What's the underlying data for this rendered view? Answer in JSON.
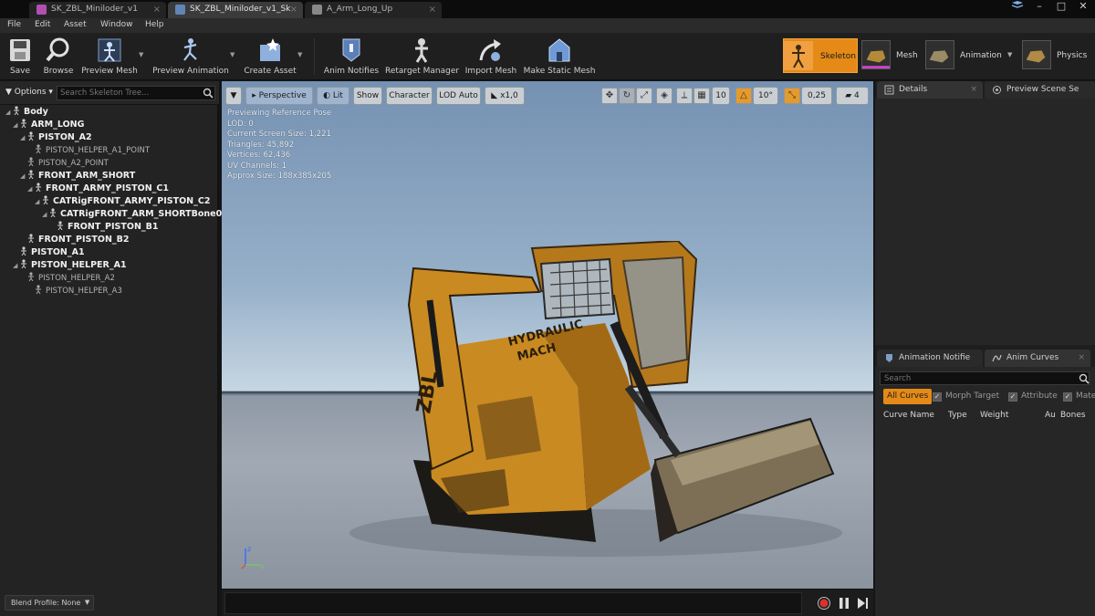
{
  "tabs": [
    {
      "label": "SK_ZBL_Miniloder_v1",
      "icon_color": "#b04fb0"
    },
    {
      "label": "SK_ZBL_Miniloder_v1_Sk",
      "icon_color": "#88c0ff"
    },
    {
      "label": "A_Arm_Long_Up",
      "icon_color": "#aaaaaa"
    }
  ],
  "window_controls": {
    "minimize": "–",
    "maximize": "□",
    "close": "✕"
  },
  "menu": [
    "File",
    "Edit",
    "Asset",
    "Window",
    "Help"
  ],
  "toolbar": {
    "buttons": [
      {
        "label": "Save",
        "icon": "save-icon"
      },
      {
        "label": "Browse",
        "icon": "browse-icon"
      },
      {
        "label": "Preview Mesh",
        "icon": "preview-mesh-icon"
      },
      {
        "label": "Preview Animation",
        "icon": "preview-animation-icon"
      },
      {
        "label": "Create Asset",
        "icon": "create-asset-icon"
      },
      {
        "label": "Anim Notifies",
        "icon": "anim-notifies-icon"
      },
      {
        "label": "Retarget Manager",
        "icon": "retarget-manager-icon"
      },
      {
        "label": "Import Mesh",
        "icon": "import-mesh-icon"
      },
      {
        "label": "Make Static Mesh",
        "icon": "make-static-mesh-icon"
      }
    ],
    "modes": [
      {
        "label": "Skeleton",
        "active": true
      },
      {
        "label": "Mesh",
        "active": false
      },
      {
        "label": "Animation",
        "active": false
      },
      {
        "label": "Physics",
        "active": false
      }
    ],
    "accent": "#e58a17"
  },
  "skeleton_panel": {
    "options_label": "Options",
    "search_placeholder": "Search Skeleton Tree...",
    "bones": [
      {
        "name": "Body",
        "strong": true
      },
      {
        "name": "ARM_LONG",
        "strong": true
      },
      {
        "name": "PISTON_A2",
        "strong": true
      },
      {
        "name": "PISTON_HELPER_A1_POINT",
        "strong": false
      },
      {
        "name": "PISTON_A2_POINT",
        "strong": false
      },
      {
        "name": "FRONT_ARM_SHORT",
        "strong": true
      },
      {
        "name": "FRONT_ARMY_PISTON_C1",
        "strong": true
      },
      {
        "name": "CATRigFRONT_ARMY_PISTON_C2",
        "strong": true
      },
      {
        "name": "CATRigFRONT_ARM_SHORTBone0",
        "strong": true
      },
      {
        "name": "FRONT_PISTON_B1",
        "strong": true
      },
      {
        "name": "FRONT_PISTON_B2",
        "strong": true
      },
      {
        "name": "PISTON_A1",
        "strong": true
      },
      {
        "name": "PISTON_HELPER_A1",
        "strong": true
      },
      {
        "name": "PISTON_HELPER_A2",
        "strong": false
      },
      {
        "name": "PISTON_HELPER_A3",
        "strong": false
      }
    ],
    "blend_profile": "Blend Profile: None"
  },
  "viewport": {
    "buttons": {
      "perspective": "Perspective",
      "lit": "Lit",
      "show": "Show",
      "character": "Character",
      "lod": "LOD Auto",
      "speed": "x1,0"
    },
    "grid_size": "10",
    "rotation_snap": "10°",
    "scale_snap": "0,25",
    "camera_speed": "4",
    "info": [
      "Previewing Reference Pose",
      "LOD: 0",
      "Current Screen Size: 1,221",
      "Triangles: 45,892",
      "Vertices: 62,436",
      "UV Channels: 1",
      "Approx Size: 188x385x205"
    ],
    "decal_text": [
      "HYDRAULIC",
      "MACH"
    ],
    "brand_text": "ZBL"
  },
  "right_panel": {
    "details_tab": "Details",
    "preview_tab": "Preview Scene Se",
    "notifies_tab": "Animation Notifie",
    "curves_tab": "Anim Curves",
    "search_placeholder": "Search",
    "filters": [
      {
        "label": "All Curves",
        "on": true
      },
      {
        "label": "Morph Target",
        "on": false
      },
      {
        "label": "Attribute",
        "on": false
      },
      {
        "label": "Mate",
        "on": false
      }
    ],
    "columns": [
      "Curve Name",
      "Type",
      "Weight",
      "Au",
      "Bones"
    ]
  }
}
